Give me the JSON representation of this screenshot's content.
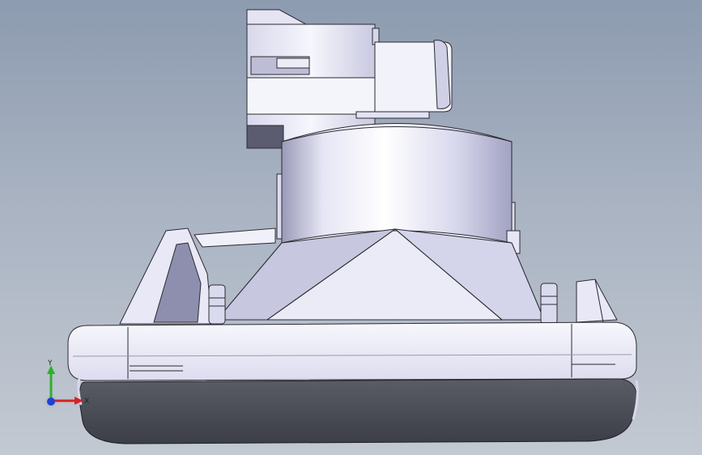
{
  "viewport": {
    "colors": {
      "bg_top": "#8d9bb0",
      "bg_bottom": "#c3c9d2",
      "part_light": "#f4f4fb",
      "part_mid": "#cfcfe6",
      "part_dark": "#8e8eae",
      "lens": "#4b4d57",
      "edge": "#2a2a33"
    }
  },
  "triad": {
    "y_label": "Y",
    "x_label": "X",
    "y_color": "#2fae2f",
    "x_color": "#d32424",
    "z_color": "#1f3fd6"
  }
}
